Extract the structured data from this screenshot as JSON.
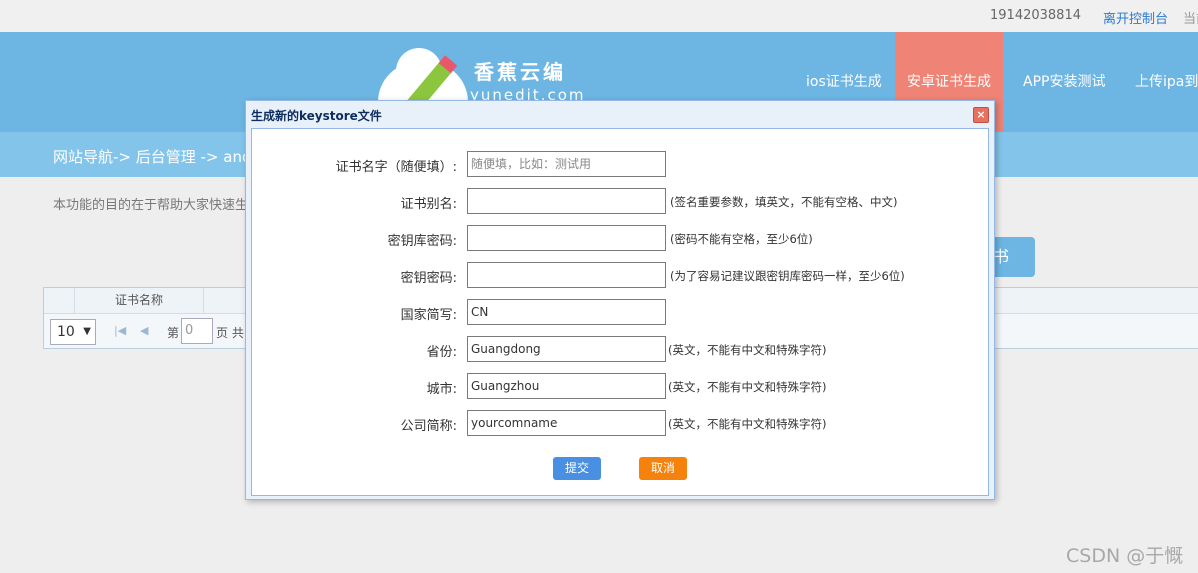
{
  "topbar": {
    "phone": "19142038814",
    "leave_label": "离开控制台",
    "current_label": "当前"
  },
  "header": {
    "logo_name": "香蕉云编",
    "logo_domain": "yunedit.com",
    "nav": [
      {
        "label": "ios证书生成",
        "active": false
      },
      {
        "label": "安卓证书生成",
        "active": true
      },
      {
        "label": "APP安装测试",
        "active": false
      },
      {
        "label": "上传ipa到a",
        "active": false
      }
    ]
  },
  "breadcrumb": "网站导航-> 后台管理 -> and",
  "description": "本功能的目的在于帮助大家快速生",
  "background_button": "书",
  "grid": {
    "header_cert_name": "证书名称",
    "pager": {
      "page_size": "10",
      "page_prefix": "第",
      "page_value": "0",
      "page_suffix": "页 共"
    }
  },
  "dialog": {
    "title": "生成新的keystore文件",
    "close_glyph": "×",
    "fields": [
      {
        "label": "证书名字（随便填）:",
        "value": "",
        "placeholder": "随便填，比如：测试用",
        "hint": ""
      },
      {
        "label": "证书别名:",
        "value": "",
        "placeholder": "",
        "hint": "(签名重要参数，填英文，不能有空格、中文)"
      },
      {
        "label": "密钥库密码:",
        "value": "",
        "placeholder": "",
        "hint": "(密码不能有空格，至少6位)"
      },
      {
        "label": "密钥密码:",
        "value": "",
        "placeholder": "",
        "hint": "(为了容易记建议跟密钥库密码一样，至少6位)"
      },
      {
        "label": "国家简写:",
        "value": "CN",
        "placeholder": "",
        "hint": ""
      },
      {
        "label": "省份:",
        "value": "Guangdong",
        "placeholder": "",
        "hint": "(英文，不能有中文和特殊字符)"
      },
      {
        "label": "城市:",
        "value": "Guangzhou",
        "placeholder": "",
        "hint": "(英文，不能有中文和特殊字符)"
      },
      {
        "label": "公司简称:",
        "value": "yourcomname",
        "placeholder": "",
        "hint": "(英文，不能有中文和特殊字符)"
      }
    ],
    "submit_label": "提交",
    "cancel_label": "取消"
  },
  "watermark": "CSDN @于慨",
  "colors": {
    "header": "#6db6e3",
    "nav_active": "#ef8376",
    "submit": "#4a90e2",
    "cancel": "#f5820d"
  }
}
